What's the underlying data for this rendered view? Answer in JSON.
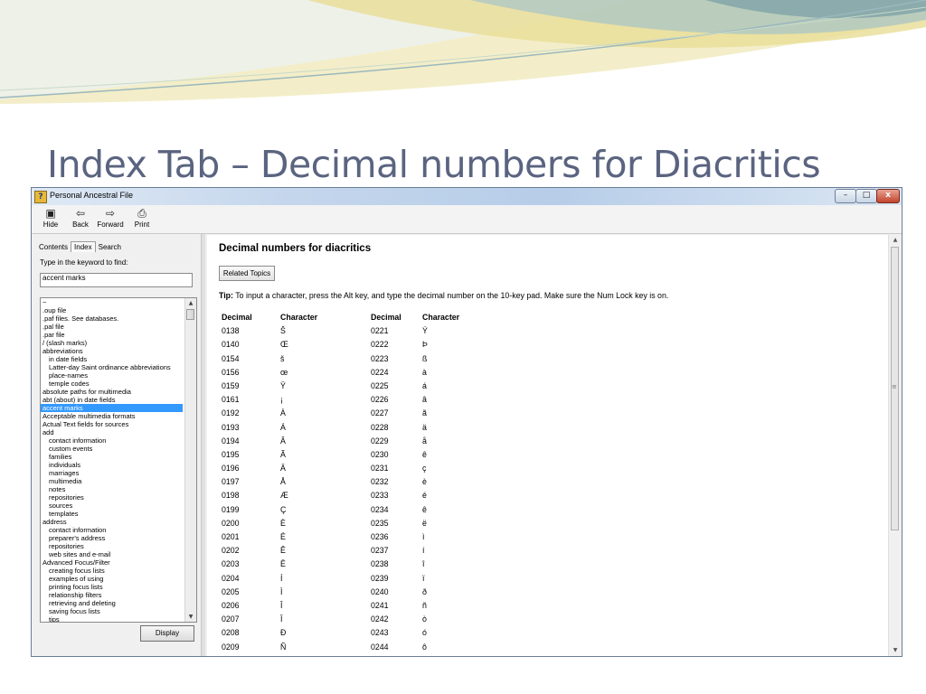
{
  "slide": {
    "title": "Index Tab – Decimal numbers for Diacritics"
  },
  "window": {
    "title": "Personal Ancestral File",
    "controls": {
      "minimize": "–",
      "maximize": "□",
      "close": "x"
    }
  },
  "toolbar": {
    "hide": {
      "label": "Hide",
      "icon": "hide-icon"
    },
    "back": {
      "label": "Back",
      "icon": "back-arrow-icon"
    },
    "forward": {
      "label": "Forward",
      "icon": "forward-arrow-icon"
    },
    "print": {
      "label": "Print",
      "icon": "printer-icon"
    }
  },
  "nav": {
    "tabs": {
      "contents": "Contents",
      "index": "Index",
      "search": "Search"
    },
    "keyword_label": "Type in the keyword to find:",
    "keyword_value": "accent marks",
    "display_button": "Display",
    "keywords": [
      {
        "text": "~",
        "indent": false
      },
      {
        "text": ".oup file",
        "indent": false
      },
      {
        "text": ".paf files. See databases.",
        "indent": false
      },
      {
        "text": ".pal file",
        "indent": false
      },
      {
        "text": ".par file",
        "indent": false
      },
      {
        "text": "/ (slash marks)",
        "indent": false
      },
      {
        "text": "abbreviations",
        "indent": false
      },
      {
        "text": "in date fields",
        "indent": true
      },
      {
        "text": "Latter-day Saint ordinance abbreviations",
        "indent": true
      },
      {
        "text": "place-names",
        "indent": true
      },
      {
        "text": "temple codes",
        "indent": true
      },
      {
        "text": "absolute paths for multimedia",
        "indent": false
      },
      {
        "text": "abt (about) in date fields",
        "indent": false
      },
      {
        "text": "accent marks",
        "indent": false,
        "selected": true
      },
      {
        "text": "Acceptable multimedia formats",
        "indent": false
      },
      {
        "text": "Actual Text fields for sources",
        "indent": false
      },
      {
        "text": "add",
        "indent": false
      },
      {
        "text": "contact information",
        "indent": true
      },
      {
        "text": "custom events",
        "indent": true
      },
      {
        "text": "families",
        "indent": true
      },
      {
        "text": "individuals",
        "indent": true
      },
      {
        "text": "marriages",
        "indent": true
      },
      {
        "text": "multimedia",
        "indent": true
      },
      {
        "text": "notes",
        "indent": true
      },
      {
        "text": "repositories",
        "indent": true
      },
      {
        "text": "sources",
        "indent": true
      },
      {
        "text": "templates",
        "indent": true
      },
      {
        "text": "address",
        "indent": false
      },
      {
        "text": "contact information",
        "indent": true
      },
      {
        "text": "preparer's address",
        "indent": true
      },
      {
        "text": "repositories",
        "indent": true
      },
      {
        "text": "web sites and e-mail",
        "indent": true
      },
      {
        "text": "Advanced Focus/Filter",
        "indent": false
      },
      {
        "text": "creating focus lists",
        "indent": true
      },
      {
        "text": "examples of using",
        "indent": true
      },
      {
        "text": "printing focus lists",
        "indent": true
      },
      {
        "text": "relationship filters",
        "indent": true
      },
      {
        "text": "retrieving and deleting",
        "indent": true
      },
      {
        "text": "saving focus lists",
        "indent": true
      },
      {
        "text": "tips",
        "indent": true
      }
    ]
  },
  "topic": {
    "title": "Decimal numbers for diacritics",
    "related_button": "Related Topics",
    "tip_label": "Tip:",
    "tip_text": " To input a character, press the Alt key, and type the decimal number on the 10-key pad. Make sure the Num Lock key is on.",
    "headers": [
      "Decimal",
      "Character",
      "Decimal",
      "Character"
    ],
    "rows": [
      [
        "0138",
        "Š",
        "0221",
        "Ý"
      ],
      [
        "0140",
        "Œ",
        "0222",
        "Þ"
      ],
      [
        "0154",
        "š",
        "0223",
        "ß"
      ],
      [
        "0156",
        "œ",
        "0224",
        "à"
      ],
      [
        "0159",
        "Ÿ",
        "0225",
        "á"
      ],
      [
        "0161",
        "¡",
        "0226",
        "â"
      ],
      [
        "0192",
        "À",
        "0227",
        "ã"
      ],
      [
        "0193",
        "Á",
        "0228",
        "ä"
      ],
      [
        "0194",
        "Â",
        "0229",
        "å"
      ],
      [
        "0195",
        "Ã",
        "0230",
        "ê"
      ],
      [
        "0196",
        "Ä",
        "0231",
        "ç"
      ],
      [
        "0197",
        "Å",
        "0232",
        "è"
      ],
      [
        "0198",
        "Æ",
        "0233",
        "é"
      ],
      [
        "0199",
        "Ç",
        "0234",
        "ê"
      ],
      [
        "0200",
        "È",
        "0235",
        "ë"
      ],
      [
        "0201",
        "É",
        "0236",
        "ì"
      ],
      [
        "0202",
        "Ê",
        "0237",
        "í"
      ],
      [
        "0203",
        "Ë",
        "0238",
        "î"
      ],
      [
        "0204",
        "Í",
        "0239",
        "ï"
      ],
      [
        "0205",
        "Ì",
        "0240",
        "ð"
      ],
      [
        "0206",
        "Î",
        "0241",
        "ñ"
      ],
      [
        "0207",
        "Ï",
        "0242",
        "ò"
      ],
      [
        "0208",
        "Ð",
        "0243",
        "ó"
      ],
      [
        "0209",
        "Ñ",
        "0244",
        "ô"
      ]
    ]
  },
  "colors": {
    "slide_title": "#5a6480",
    "selection": "#3399ff",
    "deco_gold": "#e8d98a",
    "deco_teal": "#8fb3b8"
  }
}
